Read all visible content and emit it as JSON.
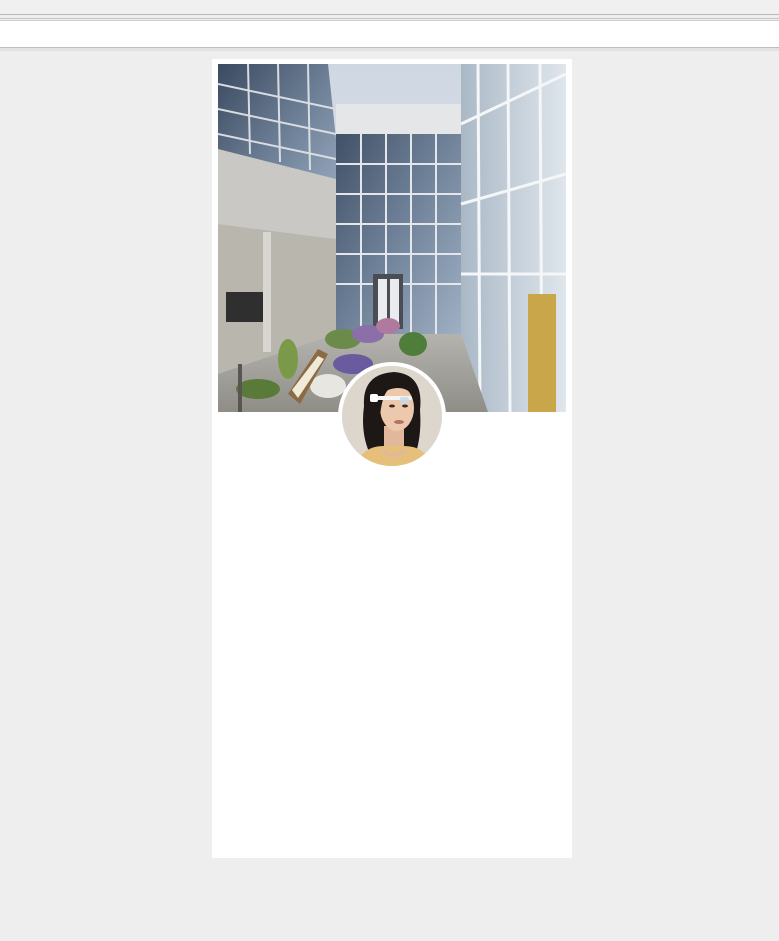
{
  "window": {
    "title": ""
  },
  "profile": {
    "cover_alt": "building-courtyard-cover-photo",
    "avatar_alt": "profile-photo",
    "name": ""
  },
  "colors": {
    "page_background": "#eeeeee",
    "card_background": "#ffffff",
    "toolbar_background": "#ffffff"
  }
}
